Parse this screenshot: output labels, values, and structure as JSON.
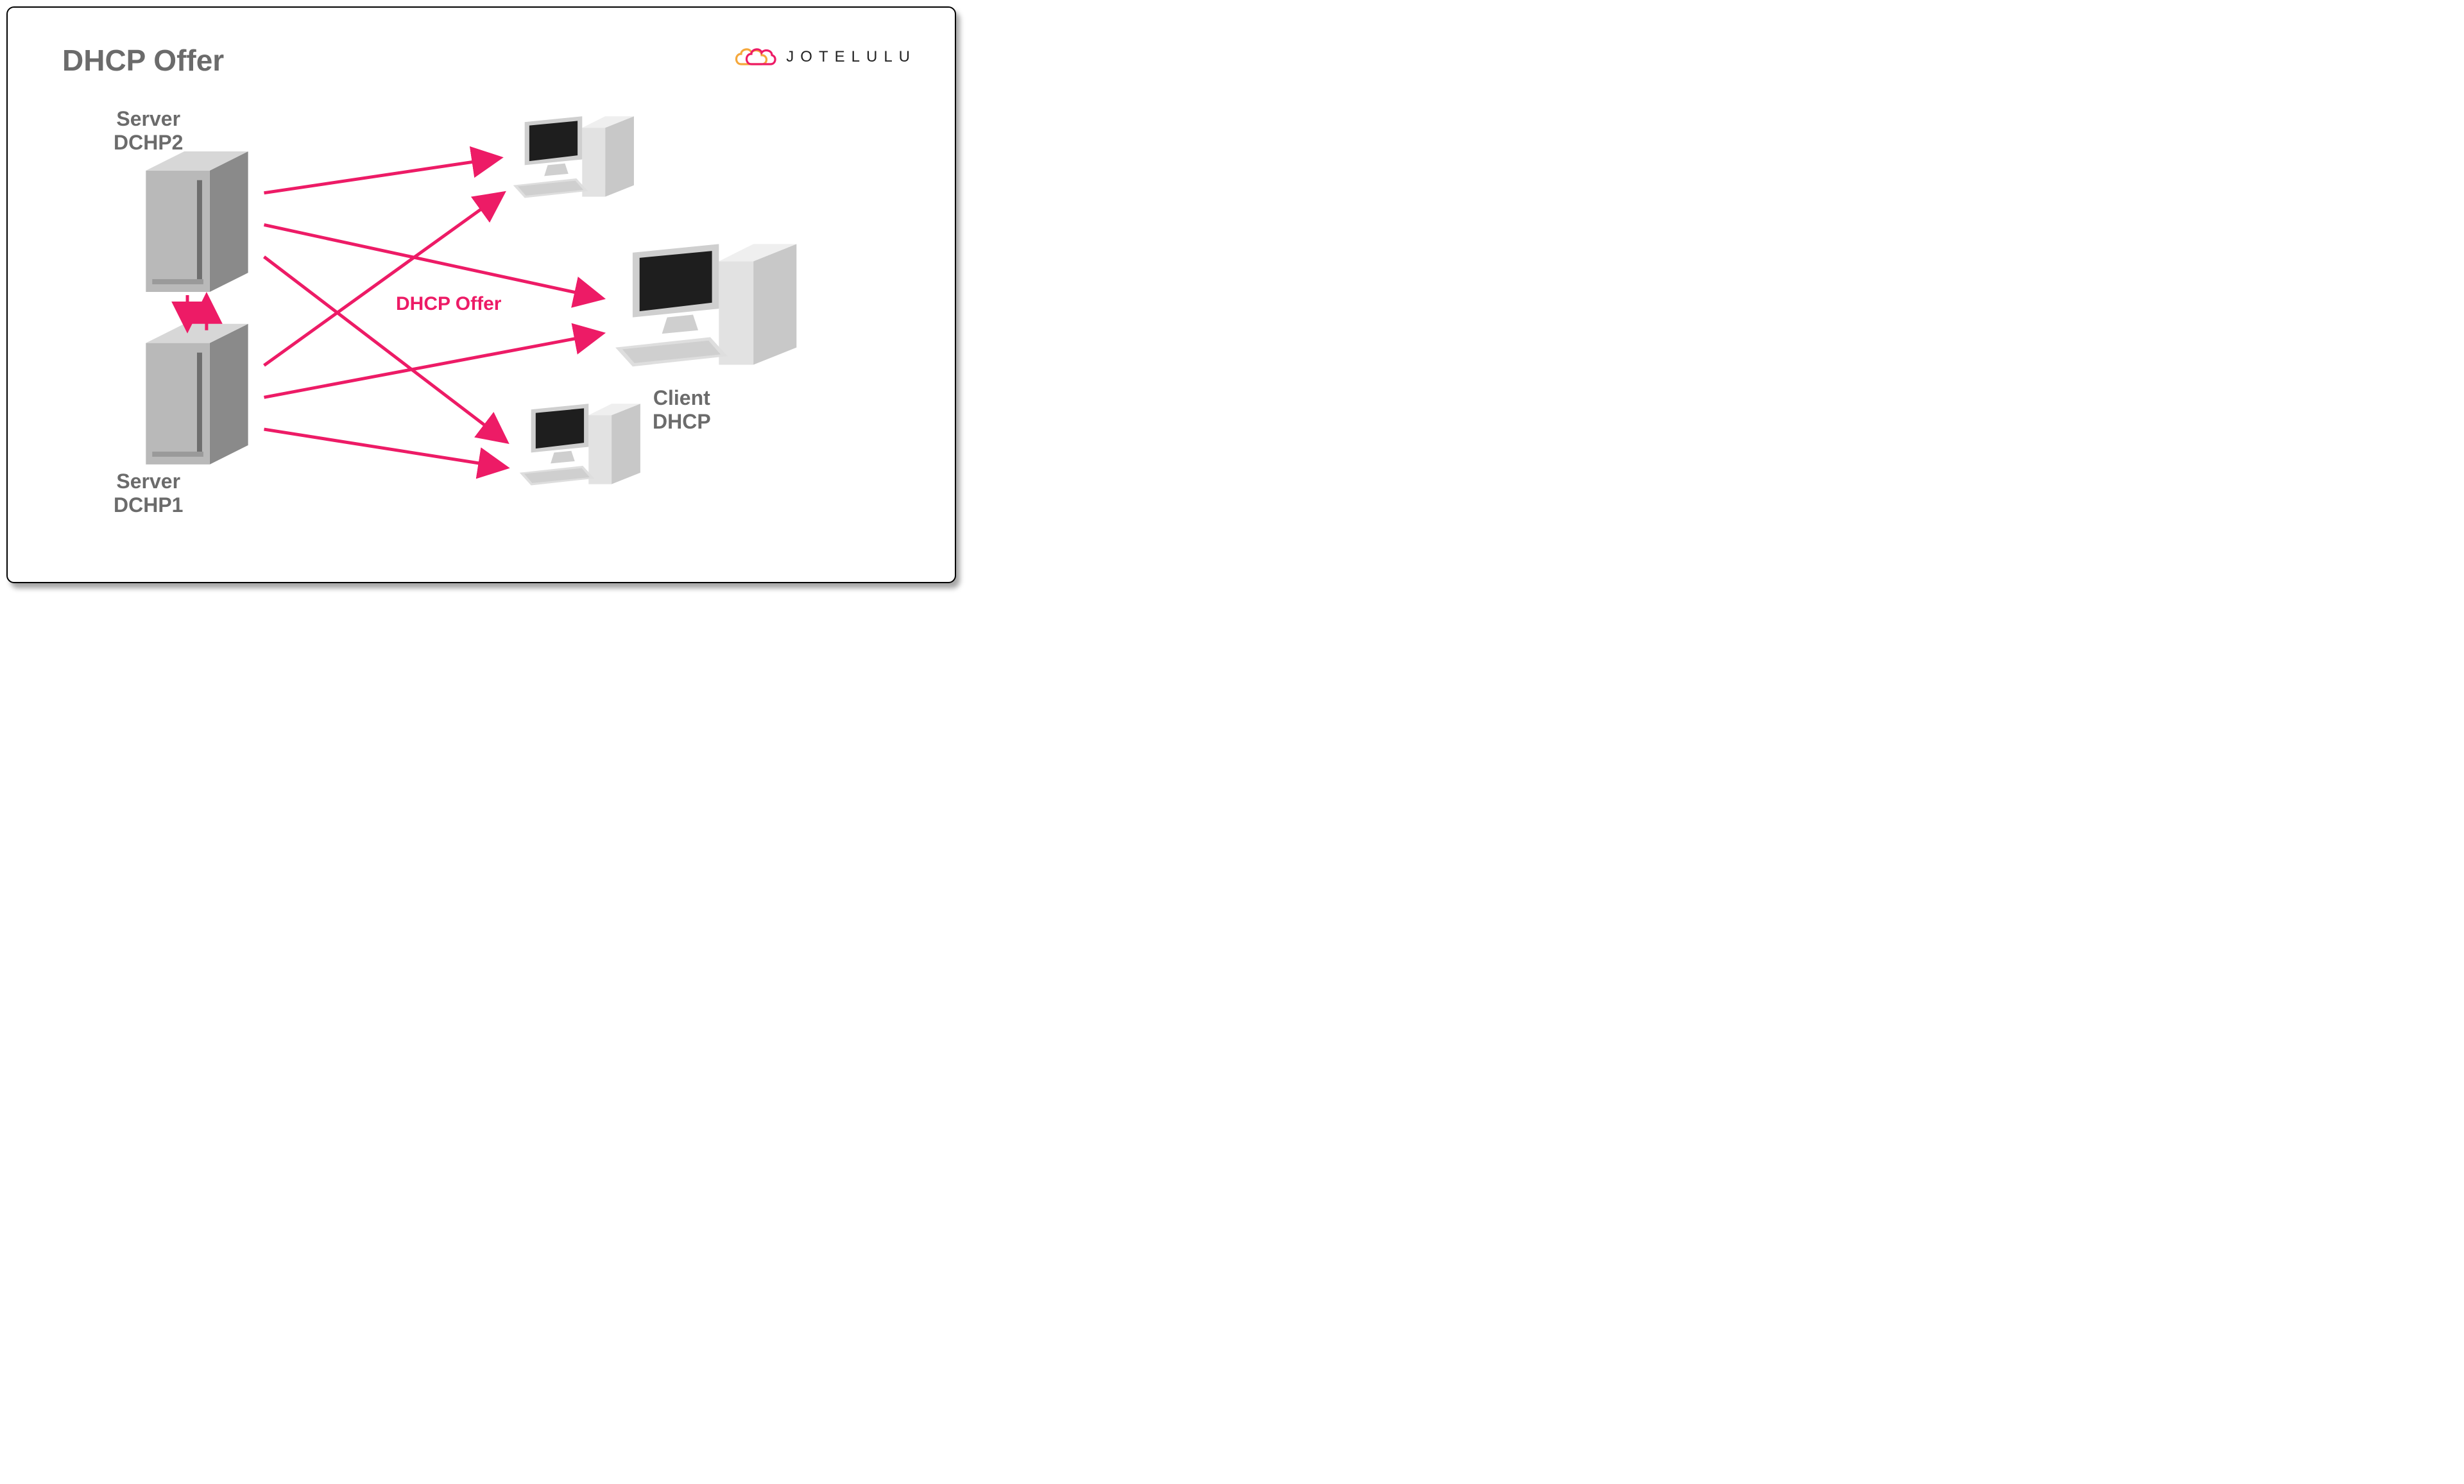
{
  "title": "DHCP Offer",
  "brand": "JOTELULU",
  "labels": {
    "server2": "Server\nDCHP2",
    "server1": "Server\nDCHP1",
    "client": "Client\nDHCP",
    "center": "DHCP Offer"
  },
  "colors": {
    "arrow": "#ed1b66",
    "text": "#6b6b6b"
  },
  "diagram": {
    "nodes": [
      {
        "id": "server-dhcp2",
        "kind": "server",
        "label_key": "server2"
      },
      {
        "id": "server-dhcp1",
        "kind": "server",
        "label_key": "server1"
      },
      {
        "id": "pc-top",
        "kind": "pc"
      },
      {
        "id": "pc-bottom",
        "kind": "pc"
      },
      {
        "id": "client-dhcp",
        "kind": "pc",
        "label_key": "client"
      }
    ],
    "arrows": [
      {
        "from": "server-dhcp2",
        "to": "pc-top"
      },
      {
        "from": "server-dhcp2",
        "to": "client-dhcp"
      },
      {
        "from": "server-dhcp2",
        "to": "pc-bottom"
      },
      {
        "from": "server-dhcp1",
        "to": "pc-top"
      },
      {
        "from": "server-dhcp1",
        "to": "client-dhcp"
      },
      {
        "from": "server-dhcp1",
        "to": "pc-bottom"
      },
      {
        "from": "server-dhcp2",
        "to": "server-dhcp1",
        "bidirectional": true
      }
    ]
  }
}
